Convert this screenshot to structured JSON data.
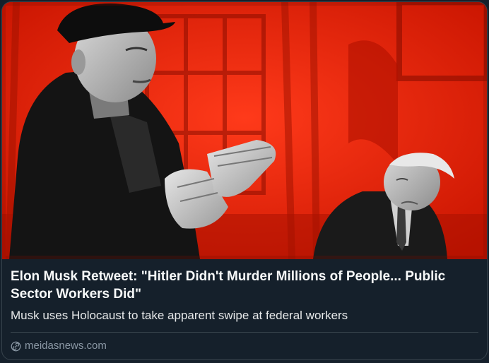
{
  "card": {
    "title": "Elon Musk Retweet: \"Hitler Didn't Murder Millions of People... Public Sector Workers Did\"",
    "description": "Musk uses Holocaust to take apparent swipe at federal workers",
    "domain": "meidasnews.com",
    "link_icon": "link-icon",
    "media_icon": "photo"
  },
  "colors": {
    "card_background": "#15202b",
    "border": "#38444d",
    "title_text": "#f7f9f9",
    "secondary_text": "#8b98a5",
    "image_red": "#e8210a"
  }
}
